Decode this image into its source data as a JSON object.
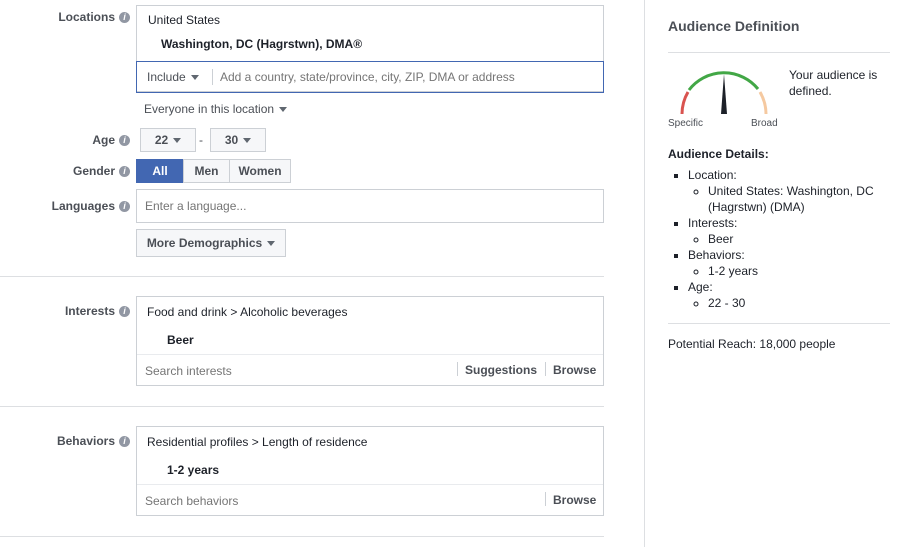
{
  "targeting": {
    "locations": {
      "label": "Locations",
      "country": "United States",
      "region": "Washington, DC (Hagrstwn), DMA®",
      "include_label": "Include",
      "placeholder": "Add a country, state/province, city, ZIP, DMA or address",
      "scope": "Everyone in this location"
    },
    "age": {
      "label": "Age",
      "min": "22",
      "separator": "-",
      "max": "30"
    },
    "gender": {
      "label": "Gender",
      "options": [
        "All",
        "Men",
        "Women"
      ],
      "selected": "All"
    },
    "languages": {
      "label": "Languages",
      "placeholder": "Enter a language..."
    },
    "more_demographics": "More Demographics",
    "interests": {
      "label": "Interests",
      "path": "Food and drink > Alcoholic beverages",
      "item": "Beer",
      "placeholder": "Search interests",
      "suggestions": "Suggestions",
      "browse": "Browse"
    },
    "behaviors": {
      "label": "Behaviors",
      "path": "Residential profiles > Length of residence",
      "item": "1-2 years",
      "placeholder": "Search behaviors",
      "browse": "Browse"
    }
  },
  "sidebar": {
    "title": "Audience Definition",
    "gauge": {
      "left_label": "Specific",
      "right_label": "Broad",
      "status": "Your audience is defined."
    },
    "details_title": "Audience Details:",
    "details": [
      {
        "label": "Location:",
        "values": [
          "United States: Washington, DC (Hagrstwn) (DMA)"
        ]
      },
      {
        "label": "Interests:",
        "values": [
          "Beer"
        ]
      },
      {
        "label": "Behaviors:",
        "values": [
          "1-2 years"
        ]
      },
      {
        "label": "Age:",
        "values": [
          "22 - 30"
        ]
      }
    ],
    "potential_reach": "Potential Reach: 18,000 people"
  },
  "colors": {
    "accent": "#4267b2",
    "gauge_green": "#42a746",
    "gauge_red": "#d9534f",
    "gauge_tan": "#f5c9a0"
  }
}
